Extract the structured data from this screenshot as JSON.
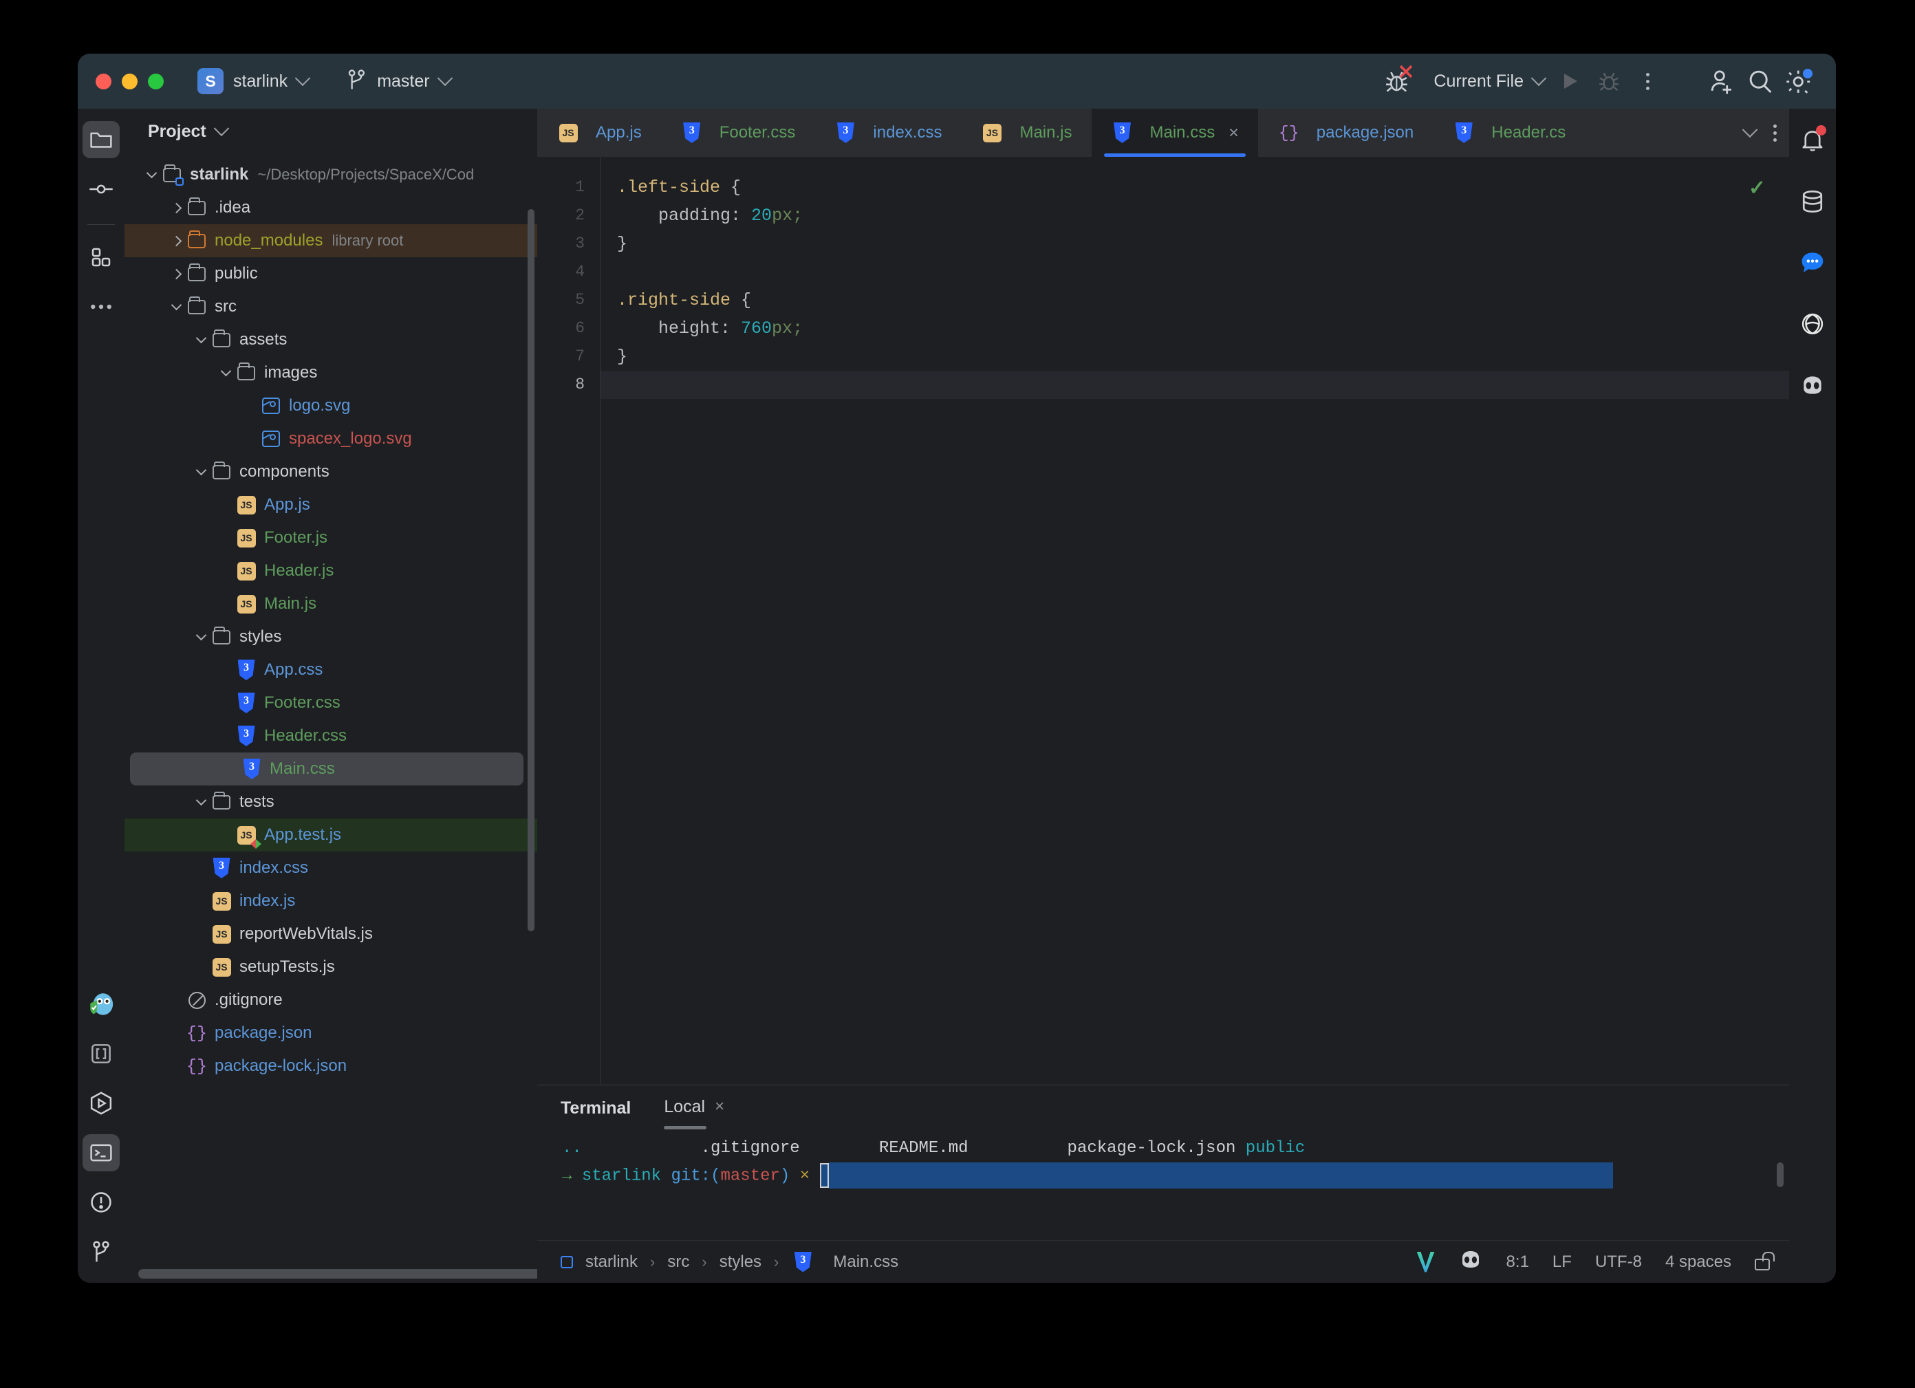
{
  "titlebar": {
    "project_badge": "S",
    "project_name": "starlink",
    "branch": "master",
    "run_config": "Current File",
    "icons": {
      "debug_failed": "bug-error-icon",
      "run": "run-icon",
      "debug": "debug-icon",
      "more": "more-options-icon",
      "add_user": "add-user-icon",
      "search": "search-icon",
      "settings": "settings-gear-icon"
    }
  },
  "left_rail": [
    {
      "name": "project-tool-window",
      "icon": "folder-icon",
      "active": true
    },
    {
      "name": "commit-tool-window",
      "icon": "commit-icon",
      "active": false
    },
    {
      "name": "plugins-tool-window",
      "icon": "grid-icon",
      "active": false
    },
    {
      "name": "more-tool-windows",
      "icon": "ellipsis-icon",
      "active": false
    },
    {
      "name": "sourcery-tool-window",
      "icon": "owl-icon",
      "active": false
    },
    {
      "name": "structure-tool-window",
      "icon": "brackets-icon",
      "active": false
    },
    {
      "name": "services-tool-window",
      "icon": "hexagon-play-icon",
      "active": false
    },
    {
      "name": "terminal-tool-window",
      "icon": "terminal-icon",
      "active": true
    },
    {
      "name": "problems-tool-window",
      "icon": "warning-circle-icon",
      "active": false
    },
    {
      "name": "git-tool-window",
      "icon": "branch-icon",
      "active": false
    }
  ],
  "right_rail": [
    {
      "name": "notifications",
      "icon": "bell-icon",
      "badge": true
    },
    {
      "name": "database",
      "icon": "database-icon",
      "badge": false
    },
    {
      "name": "ai-chat",
      "icon": "chat-bubble-icon",
      "badge": false
    },
    {
      "name": "openai",
      "icon": "openai-icon",
      "badge": false
    },
    {
      "name": "copilot",
      "icon": "copilot-icon",
      "badge": false
    }
  ],
  "project": {
    "title": "Project",
    "tree": [
      {
        "label": "starlink",
        "note": "~/Desktop/Projects/SpaceX/Cod",
        "icon": "folder-root-icon",
        "indent": 0,
        "arrow": "open",
        "color": "white",
        "bold": true,
        "bg": "none"
      },
      {
        "label": ".idea",
        "note": "",
        "icon": "folder-icon",
        "indent": 1,
        "arrow": "closed",
        "color": "white",
        "bold": false,
        "bg": "none"
      },
      {
        "label": "node_modules",
        "note": "library root",
        "icon": "folder-orange-icon",
        "indent": 1,
        "arrow": "closed",
        "color": "olive",
        "bold": false,
        "bg": "library"
      },
      {
        "label": "public",
        "note": "",
        "icon": "folder-icon",
        "indent": 1,
        "arrow": "closed",
        "color": "white",
        "bold": false,
        "bg": "none"
      },
      {
        "label": "src",
        "note": "",
        "icon": "folder-icon",
        "indent": 1,
        "arrow": "open",
        "color": "white",
        "bold": false,
        "bg": "none"
      },
      {
        "label": "assets",
        "note": "",
        "icon": "folder-icon",
        "indent": 2,
        "arrow": "open",
        "color": "white",
        "bold": false,
        "bg": "none"
      },
      {
        "label": "images",
        "note": "",
        "icon": "folder-icon",
        "indent": 3,
        "arrow": "open",
        "color": "white",
        "bold": false,
        "bg": "none"
      },
      {
        "label": "logo.svg",
        "note": "",
        "icon": "svg-image-icon",
        "indent": 4,
        "arrow": "none",
        "color": "blue",
        "bold": false,
        "bg": "none"
      },
      {
        "label": "spacex_logo.svg",
        "note": "",
        "icon": "svg-image-icon",
        "indent": 4,
        "arrow": "none",
        "color": "red",
        "bold": false,
        "bg": "none"
      },
      {
        "label": "components",
        "note": "",
        "icon": "folder-icon",
        "indent": 2,
        "arrow": "open",
        "color": "white",
        "bold": false,
        "bg": "none"
      },
      {
        "label": "App.js",
        "note": "",
        "icon": "js-icon",
        "indent": 3,
        "arrow": "none",
        "color": "blue",
        "bold": false,
        "bg": "none"
      },
      {
        "label": "Footer.js",
        "note": "",
        "icon": "js-icon",
        "indent": 3,
        "arrow": "none",
        "color": "green",
        "bold": false,
        "bg": "none"
      },
      {
        "label": "Header.js",
        "note": "",
        "icon": "js-icon",
        "indent": 3,
        "arrow": "none",
        "color": "green",
        "bold": false,
        "bg": "none"
      },
      {
        "label": "Main.js",
        "note": "",
        "icon": "js-icon",
        "indent": 3,
        "arrow": "none",
        "color": "green",
        "bold": false,
        "bg": "none"
      },
      {
        "label": "styles",
        "note": "",
        "icon": "folder-icon",
        "indent": 2,
        "arrow": "open",
        "color": "white",
        "bold": false,
        "bg": "none"
      },
      {
        "label": "App.css",
        "note": "",
        "icon": "css-icon",
        "indent": 3,
        "arrow": "none",
        "color": "blue",
        "bold": false,
        "bg": "none"
      },
      {
        "label": "Footer.css",
        "note": "",
        "icon": "css-icon",
        "indent": 3,
        "arrow": "none",
        "color": "green",
        "bold": false,
        "bg": "none"
      },
      {
        "label": "Header.css",
        "note": "",
        "icon": "css-icon",
        "indent": 3,
        "arrow": "none",
        "color": "green",
        "bold": false,
        "bg": "none"
      },
      {
        "label": "Main.css",
        "note": "",
        "icon": "css-icon",
        "indent": 3,
        "arrow": "none",
        "color": "green",
        "bold": false,
        "bg": "selected"
      },
      {
        "label": "tests",
        "note": "",
        "icon": "folder-icon",
        "indent": 2,
        "arrow": "open",
        "color": "white",
        "bold": false,
        "bg": "none"
      },
      {
        "label": "App.test.js",
        "note": "",
        "icon": "js-test-icon",
        "indent": 3,
        "arrow": "none",
        "color": "blue",
        "bold": false,
        "bg": "test"
      },
      {
        "label": "index.css",
        "note": "",
        "icon": "css-icon",
        "indent": 2,
        "arrow": "none",
        "color": "blue",
        "bold": false,
        "bg": "none"
      },
      {
        "label": "index.js",
        "note": "",
        "icon": "js-icon",
        "indent": 2,
        "arrow": "none",
        "color": "blue",
        "bold": false,
        "bg": "none"
      },
      {
        "label": "reportWebVitals.js",
        "note": "",
        "icon": "js-icon",
        "indent": 2,
        "arrow": "none",
        "color": "white",
        "bold": false,
        "bg": "none"
      },
      {
        "label": "setupTests.js",
        "note": "",
        "icon": "js-icon",
        "indent": 2,
        "arrow": "none",
        "color": "white",
        "bold": false,
        "bg": "none"
      },
      {
        "label": ".gitignore",
        "note": "",
        "icon": "gitignore-icon",
        "indent": 1,
        "arrow": "none",
        "color": "white",
        "bold": false,
        "bg": "none"
      },
      {
        "label": "package.json",
        "note": "",
        "icon": "json-icon",
        "indent": 1,
        "arrow": "none",
        "color": "blue",
        "bold": false,
        "bg": "none"
      },
      {
        "label": "package-lock.json",
        "note": "",
        "icon": "json-icon",
        "indent": 1,
        "arrow": "none",
        "color": "blue",
        "bold": false,
        "bg": "none"
      }
    ]
  },
  "editor": {
    "tabs": [
      {
        "label": "App.js",
        "icon": "js-icon",
        "color": "blue",
        "active": false,
        "closable": false
      },
      {
        "label": "Footer.css",
        "icon": "css-icon",
        "color": "green",
        "active": false,
        "closable": false
      },
      {
        "label": "index.css",
        "icon": "css-icon",
        "color": "blue",
        "active": false,
        "closable": false
      },
      {
        "label": "Main.js",
        "icon": "js-icon",
        "color": "green",
        "active": false,
        "closable": false
      },
      {
        "label": "Main.css",
        "icon": "css-icon",
        "color": "green",
        "active": true,
        "closable": true
      },
      {
        "label": "package.json",
        "icon": "json-icon",
        "color": "blue",
        "active": false,
        "closable": false
      },
      {
        "label": "Header.cs",
        "icon": "css-icon",
        "color": "green",
        "active": false,
        "closable": false
      }
    ],
    "tab_close_label": "×",
    "line_numbers": [
      "1",
      "2",
      "3",
      "4",
      "5",
      "6",
      "7",
      "8"
    ],
    "current_line": 8,
    "inspection_status": "✓",
    "code_lines": [
      {
        "selector": ".left-side",
        "rest": " {",
        "prop": "",
        "num": "",
        "unit": "",
        "semi": ""
      },
      {
        "selector": "",
        "rest": "",
        "prop": "    padding: ",
        "num": "20",
        "unit": "px",
        "semi": ";"
      },
      {
        "selector": "",
        "rest": "}",
        "prop": "",
        "num": "",
        "unit": "",
        "semi": ""
      },
      {
        "selector": "",
        "rest": "",
        "prop": "",
        "num": "",
        "unit": "",
        "semi": ""
      },
      {
        "selector": ".right-side",
        "rest": " {",
        "prop": "",
        "num": "",
        "unit": "",
        "semi": ""
      },
      {
        "selector": "",
        "rest": "",
        "prop": "    height: ",
        "num": "760",
        "unit": "px",
        "semi": ";"
      },
      {
        "selector": "",
        "rest": "}",
        "prop": "",
        "num": "",
        "unit": "",
        "semi": ""
      },
      {
        "selector": "",
        "rest": "",
        "prop": "",
        "num": "",
        "unit": "",
        "semi": ""
      }
    ]
  },
  "terminal": {
    "title": "Terminal",
    "tab": "Local",
    "close_label": "×",
    "ls_output": {
      "dots": "..",
      "gitignore": ".gitignore",
      "readme": "README.md",
      "lockfile": "package-lock.json",
      "public_dir": "public"
    },
    "prompt": {
      "arrow": "→",
      "cwd": "starlink",
      "git_label": "git:",
      "branch_open": "(",
      "branch": "master",
      "branch_close": ")",
      "dirty": "×"
    }
  },
  "statusbar": {
    "breadcrumb": [
      "starlink",
      "src",
      "styles",
      "Main.css"
    ],
    "separator": "›",
    "caret_position": "8:1",
    "line_separator": "LF",
    "encoding": "UTF-8",
    "indent": "4 spaces",
    "icons": {
      "vite": "vite-logo-icon",
      "copilot": "copilot-icon",
      "lock": "unlocked-padlock-icon"
    }
  },
  "colors": {
    "accent_blue": "#3574f0",
    "titlebar_bg": "#27343c",
    "panel_bg": "#1e1f22",
    "tabbar_bg": "#2b2d30",
    "selection_bg": "#43454a",
    "library_root_bg": "#3d2e23",
    "test_bg": "#22331f",
    "terminal_selection": "#1c4a85"
  }
}
